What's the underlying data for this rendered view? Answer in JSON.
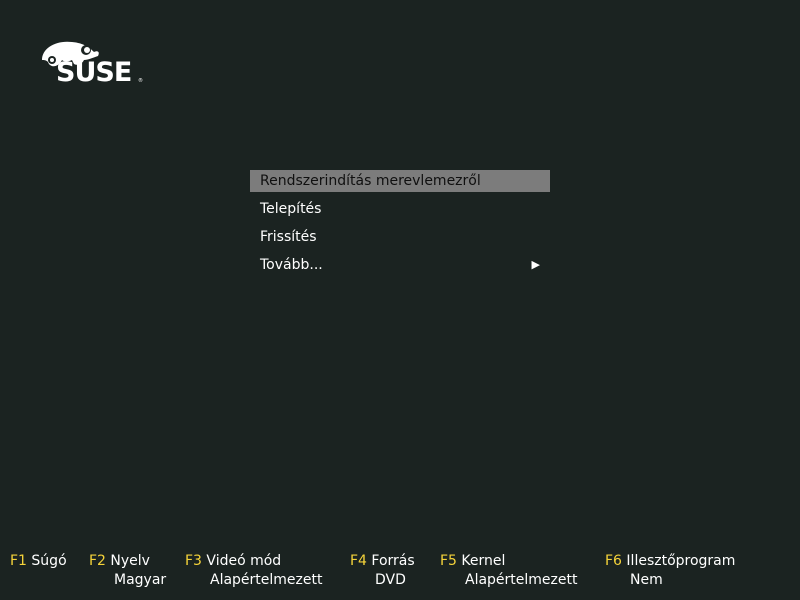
{
  "logo": {
    "text": "SUSE",
    "mark": "®",
    "icon": "chameleon-icon",
    "color": "#ffffff"
  },
  "menu": {
    "items": [
      {
        "label": "Rendszerindítás merevlemezről",
        "selected": true
      },
      {
        "label": "Telepítés",
        "selected": false
      },
      {
        "label": "Frissítés",
        "selected": false
      },
      {
        "label": "Tovább...",
        "selected": false,
        "submenu_icon": "▶"
      }
    ],
    "selected_bg": "#7c7c7c"
  },
  "fkeys": [
    {
      "key": "F1",
      "label": "Súgó",
      "value": ""
    },
    {
      "key": "F2",
      "label": "Nyelv",
      "value": "Magyar"
    },
    {
      "key": "F3",
      "label": "Videó mód",
      "value": "Alapértelmezett"
    },
    {
      "key": "F4",
      "label": "Forrás",
      "value": "DVD"
    },
    {
      "key": "F5",
      "label": "Kernel",
      "value": "Alapértelmezett"
    },
    {
      "key": "F6",
      "label": "Illesztőprogram",
      "value": "Nem"
    }
  ],
  "colors": {
    "background": "#1b2321",
    "fkey_accent": "#f5d33a",
    "text": "#ffffff"
  }
}
